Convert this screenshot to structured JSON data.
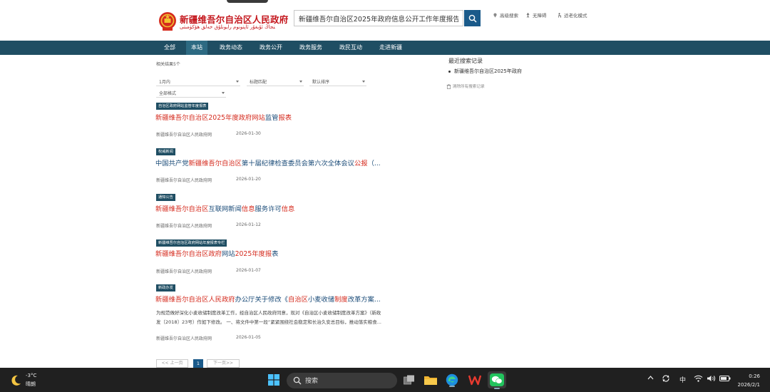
{
  "header": {
    "site_title": "新疆维吾尔自治区人民政府",
    "site_subtitle": "شىنجاڭ ئۇيغۇر ئاپتونوم رايونلۇق خەلق ھۆكۈمىتى",
    "search_value": "新疆维吾尔自治区2025年政府信息公开工作年度报告",
    "tools": [
      "高级搜索",
      "无障碍",
      "适老化模式"
    ]
  },
  "nav": {
    "items": [
      "全部",
      "本站",
      "政务动态",
      "政务公开",
      "政务服务",
      "政民互动",
      "走进新疆"
    ],
    "active_index": 1
  },
  "filters": {
    "result_count": "相关结果5个",
    "time": "1月内",
    "match": "标题匹配",
    "sort": "默认排序",
    "format": "全部格式"
  },
  "results": [
    {
      "tag": "自治区政府网站监管年度报表",
      "title_parts": [
        {
          "text": "新疆维吾尔自治区2025年度政府网站",
          "hl": true
        },
        {
          "text": "监管",
          "hl": false
        },
        {
          "text": "报表",
          "hl": true
        }
      ],
      "source": "新疆维吾尔自治区人民政府网",
      "date": "2026-01-30"
    },
    {
      "tag": "权威新闻",
      "title_parts": [
        {
          "text": "中国共产党",
          "hl": false
        },
        {
          "text": "新疆维吾尔自治区",
          "hl": true
        },
        {
          "text": "第十届纪律检查委员会第六次全体会议",
          "hl": false
        },
        {
          "text": "公报",
          "hl": true
        },
        {
          "text": "（...",
          "hl": false
        }
      ],
      "source": "新疆维吾尔自治区人民政府网",
      "date": "2026-01-20"
    },
    {
      "tag": "通知公告",
      "title_parts": [
        {
          "text": "新疆维吾尔自治区",
          "hl": true
        },
        {
          "text": "互联网新闻",
          "hl": false
        },
        {
          "text": "信息",
          "hl": true
        },
        {
          "text": "服务许可",
          "hl": false
        },
        {
          "text": "信息",
          "hl": true
        }
      ],
      "source": "新疆维吾尔自治区人民政府网",
      "date": "2026-01-12"
    },
    {
      "tag": "新疆维吾尔自治区政府网站年度报表专栏",
      "title_parts": [
        {
          "text": "新疆维吾尔自治区政府",
          "hl": true
        },
        {
          "text": "网站",
          "hl": false
        },
        {
          "text": "2025年度报",
          "hl": true
        },
        {
          "text": "表",
          "hl": false
        }
      ],
      "source": "新疆维吾尔自治区人民政府网",
      "date": "2026-01-07"
    },
    {
      "tag": "新政办发",
      "title_parts": [
        {
          "text": "新疆维吾尔自治区人民政府",
          "hl": true
        },
        {
          "text": "办公厅关于修改《",
          "hl": false
        },
        {
          "text": "自治区",
          "hl": true
        },
        {
          "text": "小麦收储",
          "hl": false
        },
        {
          "text": "制度",
          "hl": true
        },
        {
          "text": "改革方案...",
          "hl": false
        }
      ],
      "snippet": [
        "为规范做好深化小麦收储制度改革工作，经自治区人民政府同意，现对《自治区小麦收储制度改革方案》（新政",
        "发〔2018〕23号）作如下修改。 一、将文件中第一段“紧紧围绕社会稳定和长治久安总目标，推动落实粮食..."
      ],
      "source": "新疆维吾尔自治区人民政府网",
      "date": "2026-01-05"
    }
  ],
  "pagination": {
    "prev": "<< 上一页",
    "current": "1",
    "next": "下一页>>"
  },
  "sidebar": {
    "recent_title": "最近搜索记录",
    "recent_item": "新疆维吾尔自治区2025年政府",
    "clear_label": "清除所有搜索记录"
  },
  "taskbar": {
    "temperature": "-3°C",
    "condition": "晴朗",
    "search_label": "搜索",
    "ime": "中",
    "time": "0:26",
    "date": "2026/2/1"
  },
  "colors": {
    "nav_bg": "#1f4e63",
    "highlight": "#d52b1e",
    "link": "#1a4b78",
    "brand_red": "#c4161c"
  }
}
